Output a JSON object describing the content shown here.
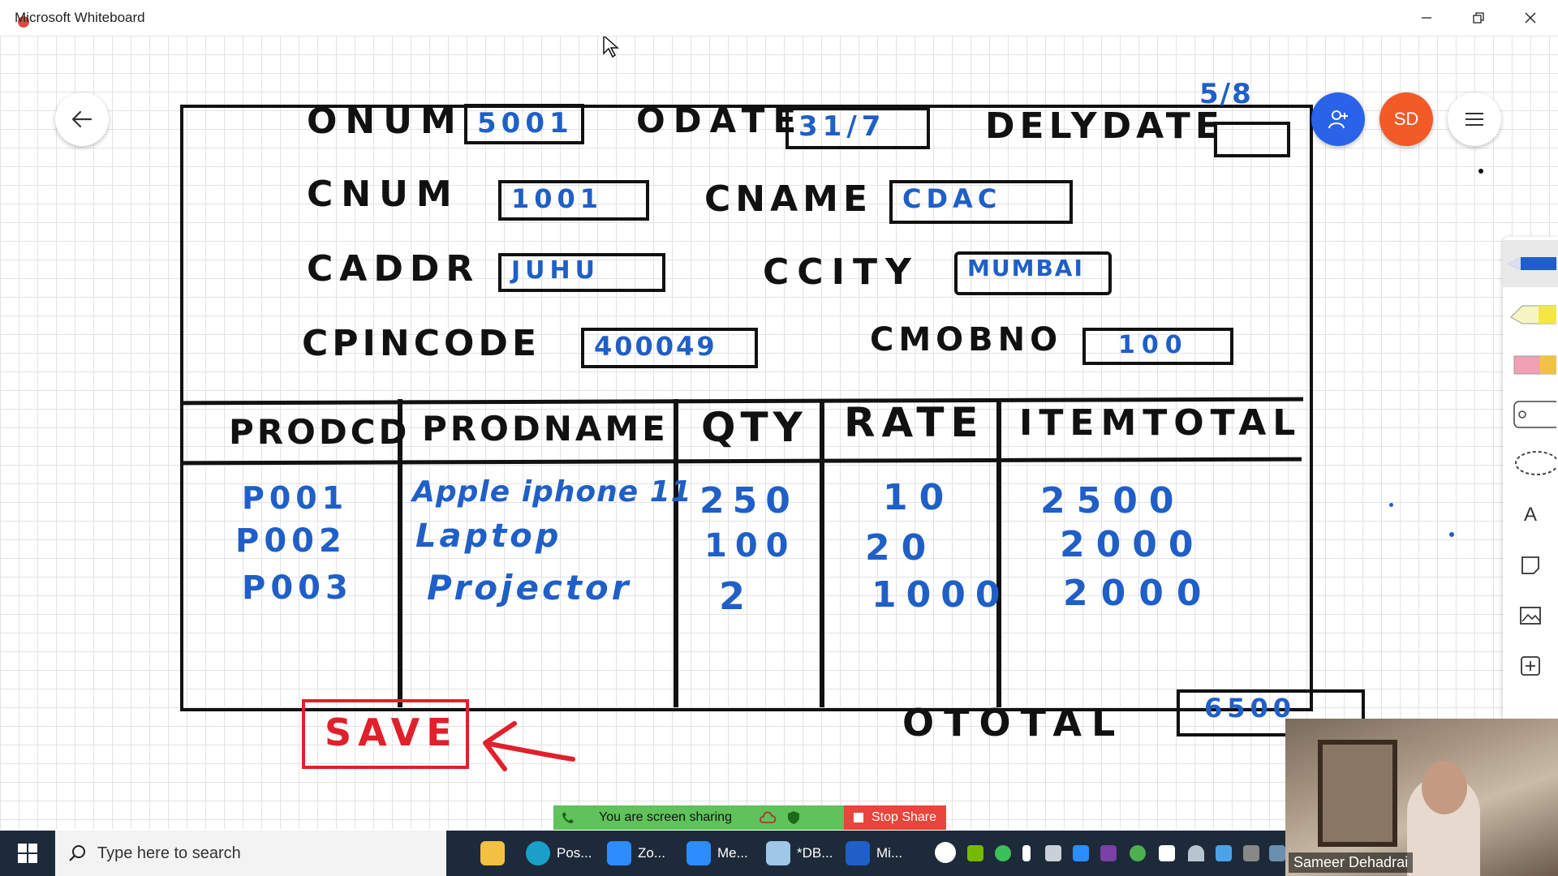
{
  "window": {
    "title": "Microsoft Whiteboard"
  },
  "form": {
    "onum_label": "ONUM",
    "onum_value": "5001",
    "odate_label": "ODATE",
    "odate_value": "31/7",
    "delydate_label": "DELYDATE",
    "delydate_note": "5/8",
    "delydate_value": "",
    "cnum_label": "CNUM",
    "cnum_value": "1001",
    "cname_label": "CNAME",
    "cname_value": "CDAC",
    "caddr_label": "CADDR",
    "caddr_value": "JUHU",
    "ccity_label": "CCITY",
    "ccity_value": "MUMBAI",
    "cpincode_label": "CPINCODE",
    "cpincode_value": "400049",
    "cmobno_label": "CMOBNO",
    "cmobno_value": "100"
  },
  "table": {
    "headers": [
      "PRODCD",
      "PRODNAME",
      "QTY",
      "RATE",
      "ITEMTOTAL"
    ],
    "rows": [
      [
        "P001",
        "Apple iphone 11",
        "250",
        "10",
        "2500"
      ],
      [
        "P002",
        "Laptop",
        "100",
        "20",
        "2000"
      ],
      [
        "P003",
        "Projector",
        "2",
        "1000",
        "2000"
      ]
    ]
  },
  "save_label": "SAVE",
  "ototal_label": "OTOTAL",
  "ototal_value": "6500",
  "controls": {
    "avatar_initials": "SD"
  },
  "share_banner": {
    "status": "You are screen sharing",
    "stop_label": "Stop Share"
  },
  "webcam": {
    "name": "Sameer Dehadrai"
  },
  "taskbar": {
    "search_placeholder": "Type here to search",
    "apps": [
      "Pos...",
      "Zo...",
      "Me...",
      "*DB...",
      "Mi..."
    ]
  },
  "colors": {
    "ink_black": "#111111",
    "ink_blue": "#1f5fc7",
    "ink_red": "#e0202a",
    "collab_blue": "#2a62e8",
    "avatar_orange": "#f25a28",
    "share_green": "#5fc25a",
    "share_red": "#e8453c",
    "taskbar": "#1d2a3a"
  }
}
